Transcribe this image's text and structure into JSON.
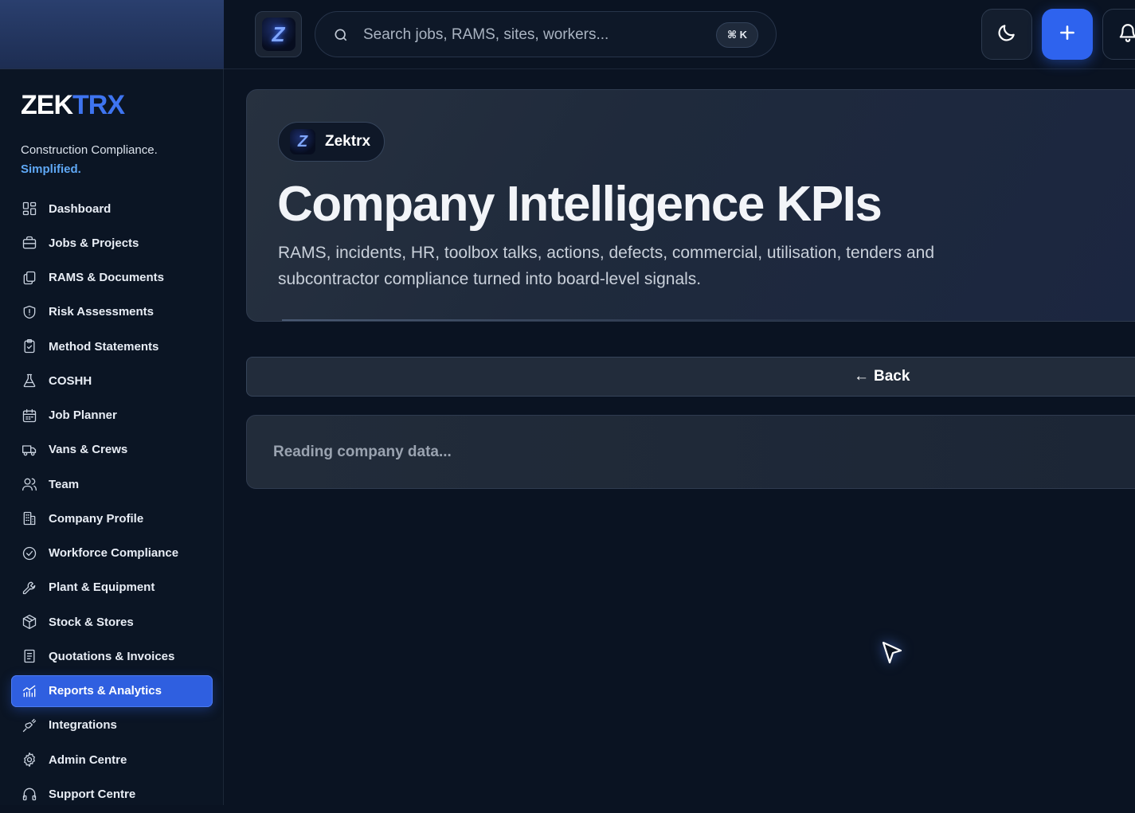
{
  "brand": {
    "logo_part1": "ZEK",
    "logo_part2": "TRX",
    "tagline": "Construction Compliance.",
    "tagline_accent": "Simplified.",
    "badge_letter": "Z"
  },
  "search": {
    "placeholder": "Search jobs, RAMS, sites, workers...",
    "shortcut": "⌘ K"
  },
  "topbar": {
    "theme_icon": "moon-icon",
    "add_icon": "plus-icon",
    "notifications_icon": "bell-icon"
  },
  "sidebar": {
    "items": [
      {
        "label": "Dashboard",
        "icon": "grid-icon"
      },
      {
        "label": "Jobs & Projects",
        "icon": "briefcase-icon"
      },
      {
        "label": "RAMS & Documents",
        "icon": "documents-icon"
      },
      {
        "label": "Risk Assessments",
        "icon": "shield-icon"
      },
      {
        "label": "Method Statements",
        "icon": "clipboard-icon"
      },
      {
        "label": "COSHH",
        "icon": "flask-icon"
      },
      {
        "label": "Job Planner",
        "icon": "calendar-icon"
      },
      {
        "label": "Vans & Crews",
        "icon": "truck-icon"
      },
      {
        "label": "Team",
        "icon": "users-icon"
      },
      {
        "label": "Company Profile",
        "icon": "building-icon"
      },
      {
        "label": "Workforce Compliance",
        "icon": "check-circle-icon"
      },
      {
        "label": "Plant & Equipment",
        "icon": "wrench-icon"
      },
      {
        "label": "Stock & Stores",
        "icon": "box-icon"
      },
      {
        "label": "Quotations & Invoices",
        "icon": "invoice-icon"
      },
      {
        "label": "Reports & Analytics",
        "icon": "chart-icon",
        "active": true
      },
      {
        "label": "Integrations",
        "icon": "plug-icon"
      },
      {
        "label": "Admin Centre",
        "icon": "gear-icon"
      },
      {
        "label": "Support Centre",
        "icon": "headphones-icon"
      }
    ]
  },
  "hero": {
    "company_name": "Zektrx",
    "title": "Company Intelligence KPIs",
    "subtitle": "RAMS, incidents, HR, toolbox talks, actions, defects, commercial, utilisation, tenders and subcontractor compliance turned into board-level signals."
  },
  "back_button": {
    "arrow": "←",
    "label": "Back"
  },
  "loading": {
    "text": "Reading company data..."
  },
  "colors": {
    "accent": "#2f5fe0",
    "logo_accent": "#3e74f0",
    "tagline_accent": "#5fa8f5",
    "background": "#0a1322"
  }
}
